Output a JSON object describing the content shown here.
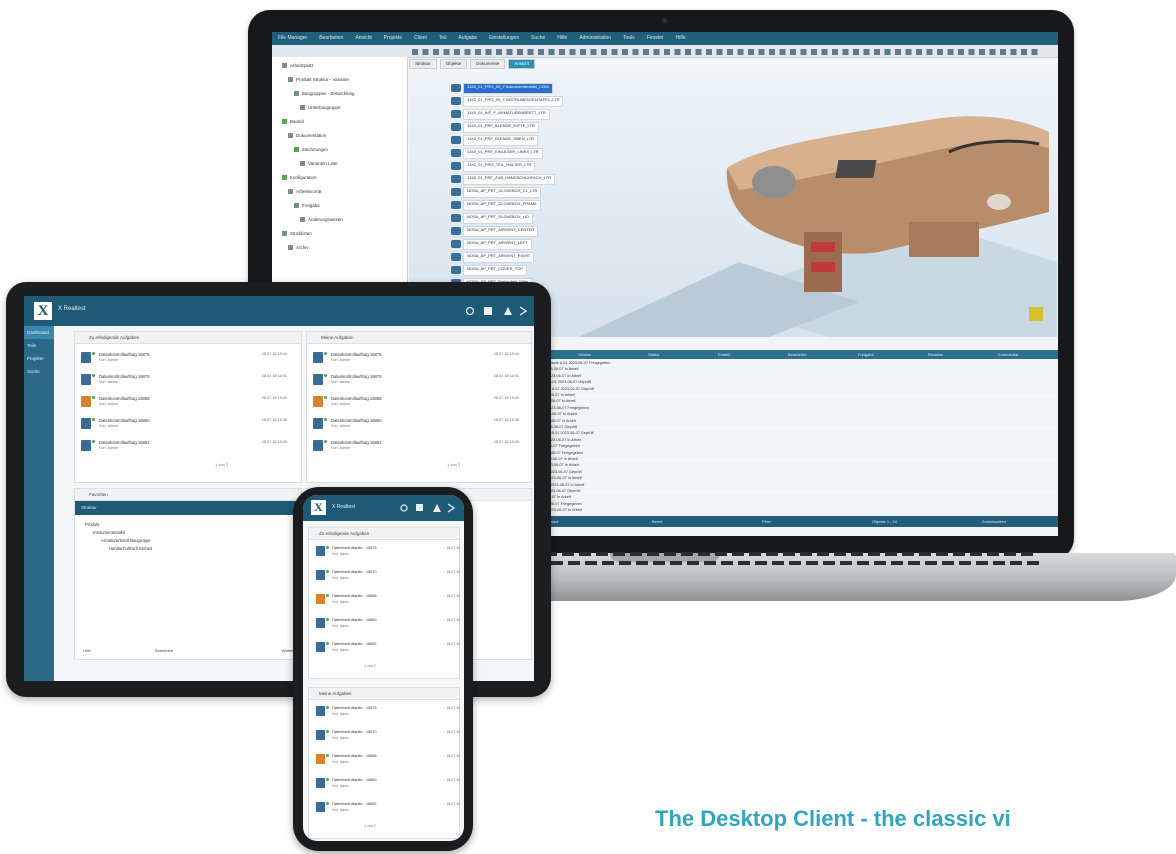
{
  "caption": "The Desktop Client - the classic vi",
  "laptop": {
    "menu": [
      "File Manager",
      "Bearbeiten",
      "Ansicht",
      "Projekte",
      "Client",
      "Teil",
      "Aufgabe",
      "Einstellungen",
      "Suche",
      "Hilfe",
      "Administration",
      "Tools",
      "Fenster",
      "Hilfe"
    ],
    "tabs": [
      "Struktur",
      "Objekte",
      "Dokumente",
      "Ansicht"
    ],
    "tree_items": [
      {
        "label": "Arbeitsplatz",
        "green": false
      },
      {
        "label": "Produkt Struktur - Variante",
        "green": false
      },
      {
        "label": "Baugruppen - Entwicklung",
        "green": false
      },
      {
        "label": "Unterbaugruppe",
        "green": false
      },
      {
        "label": "Bauteil",
        "green": true
      },
      {
        "label": "Dokumentation",
        "green": false
      },
      {
        "label": "Zeichnungen",
        "green": true
      },
      {
        "label": "Varianten Liste",
        "green": false
      },
      {
        "label": "Konfiguration",
        "green": true
      },
      {
        "label": "Arbeitsvorrat",
        "green": false
      },
      {
        "label": "Freigabe",
        "green": false
      },
      {
        "label": "Änderungswesen",
        "green": false
      },
      {
        "label": "Stücklisten",
        "green": false
      },
      {
        "label": "Archiv",
        "green": false
      }
    ],
    "objects": [
      "1343_01_PRO_00_Y Instrumententafel_COM",
      "1343_01_PRO_00_Y INSTRUMENTENTAFEL_LTR",
      "1343_01_INT_F_ARMATURENBRETT_LTR",
      "1343_01_PRF_BLENDE_MITTE_LTR",
      "1343_01_PRF_BLENDE_OBEN_LTR",
      "1343_01_PRF_EINLEGER_LINKS_LTR",
      "1343_01_PRO_TEIL_HALTER_LTR",
      "1343_01_PRF_ZUB_HANDSCHUHFACH_LTR",
      "NOSA_AP_PRT_GLOVEBOX_CL_LTR",
      "NOSA_AP_PRT_GLOVEBOX_FRAME",
      "NOSA_AP_PRT_GLOVEBOX_LID",
      "NOSA_AP_PRT_AIRVENT_CENTER",
      "NOSA_AP_PRT_AIRVENT_LEFT",
      "NOSA_AP_PRT_AIRVENT_RIGHT",
      "NOSA_AP_PRT_COVER_TOP",
      "NOSA_AP_PRT_Bedienfeld_Mitte",
      "NOSA_AP_PRT_Bedienfeld_Seite"
    ],
    "columns": [
      "Name",
      "Version",
      "Status",
      "Erstellt",
      "Bearbeiter",
      "Freigabe",
      "Revision",
      "Kommentar"
    ],
    "rows": [
      "Bedienteil_CTR_Mittelkonsole  A.01  2023-06-07  Freigegeben",
      "Luftduese_links  A.01  2023-06-07  In Arbeit",
      "Luftduese_rechts  A.01  2023-06-07  In Arbeit",
      "Handschuhfach_Deckel  A.01  2023-06-07  Geprüft",
      "Handschuhfach_Rahmen  A.02  2023-06-07  Geprüft",
      "Blende_oben  A.01  2023-06-07  In Arbeit",
      "Blende_unten  A.01  2023-06-07  In Arbeit",
      "Abdeckung_Mitte  A.01  2023-06-07  Freigegeben",
      "Halter_Display  A.01  2023-06-07  In Arbeit",
      "Einleger_links  A.01  2023-06-07  In Arbeit",
      "Einleger_rechts  A.01  2023-06-07  Geprüft",
      "Träger_Instrumententafel  B.01  2023-06-07  Geprüft",
      "Kabelkanal_Mitte  A.01  2023-06-07  In Arbeit",
      "Clip_Blende  A.01  2023-06-07  Freigegeben",
      "Schraube_M6  A.01  2023-06-07  Freigegeben",
      "Dichtung_oben  A.01  2023-06-07  In Arbeit",
      "Dichtung_unten  A.01  2023-06-07  In Arbeit",
      "Deckel_Sicherung  A.01  2023-06-07  Geprüft",
      "Verkleidung_links  A.01  2023-06-07  In Arbeit",
      "Verkleidung_rechts  A.01  2023-06-07  In Arbeit",
      "Rahmen_Display  A.01  2023-06-07  Geprüft",
      "Leiste_Zier  A.01  2023-06-07  In Arbeit",
      "Fach_Ablage  A.01  2023-06-07  Freigegeben",
      "Abdeckung_Seite  A.01  2023-06-07  In Arbeit"
    ],
    "status_bar": [
      "Standard",
      "Bereit",
      "Filter",
      "Objekte 1 - 24",
      "Zurücksetzen"
    ]
  },
  "tablet": {
    "title": "X Realtest",
    "sidebar": [
      "Dashboard",
      "Teile",
      "Projekte",
      "Suche"
    ],
    "panel1_title": "Zu erledigende Aufgaben",
    "panel2_title": "Meine Aufgaben",
    "panel3_title": "Favoriten",
    "panel4_title": "Struktur",
    "items": [
      {
        "t1": "Datenkontrollauftrag 16875",
        "t2": "Von: admin",
        "r1": "28.07.18 15:44",
        "warn": false
      },
      {
        "t1": "Datenkontrollauftrag 16870",
        "t2": "Von: admin",
        "r1": "28.07.18 15:41",
        "warn": false
      },
      {
        "t1": "Datenkontrollauftrag 16868",
        "t2": "Von: admin",
        "r1": "28.07.18 15:40",
        "warn": true
      },
      {
        "t1": "Datenkontrollauftrag 16860",
        "t2": "Von: admin",
        "r1": "28.07.18 15:38",
        "warn": false
      },
      {
        "t1": "Datenkontrollauftrag 16852",
        "t2": "Von: admin",
        "r1": "28.07.18 15:35",
        "warn": false
      }
    ],
    "pager": "1 von 2",
    "struct_title": "Produkt",
    "struct_items": [
      "Instrumententafel",
      "Armaturenbrett Baugruppe",
      "Handschuhfach Einheit"
    ],
    "footer_left": "Hilfe",
    "footer_mid": "Abmelden",
    "footer_right": "Weiter"
  },
  "phone": {
    "title": "X Realtest",
    "panel1_title": "Zu erledigende Aufgaben",
    "panel2_title": "Meine Aufgaben",
    "items": [
      {
        "t1": "Datenkontrollauftr... 16875",
        "t2": "Von: admin",
        "r1": "28.07.18",
        "warn": false
      },
      {
        "t1": "Datenkontrollauftr... 16870",
        "t2": "Von: admin",
        "r1": "28.07.18",
        "warn": false
      },
      {
        "t1": "Datenkontrollauftr... 16868",
        "t2": "Von: admin",
        "r1": "28.07.18",
        "warn": true
      },
      {
        "t1": "Datenkontrollauftr... 16860",
        "t2": "Von: admin",
        "r1": "28.07.18",
        "warn": false
      },
      {
        "t1": "Datenkontrollauftr... 16852",
        "t2": "Von: admin",
        "r1": "28.07.18",
        "warn": false
      }
    ],
    "pager": "1 von 2"
  }
}
